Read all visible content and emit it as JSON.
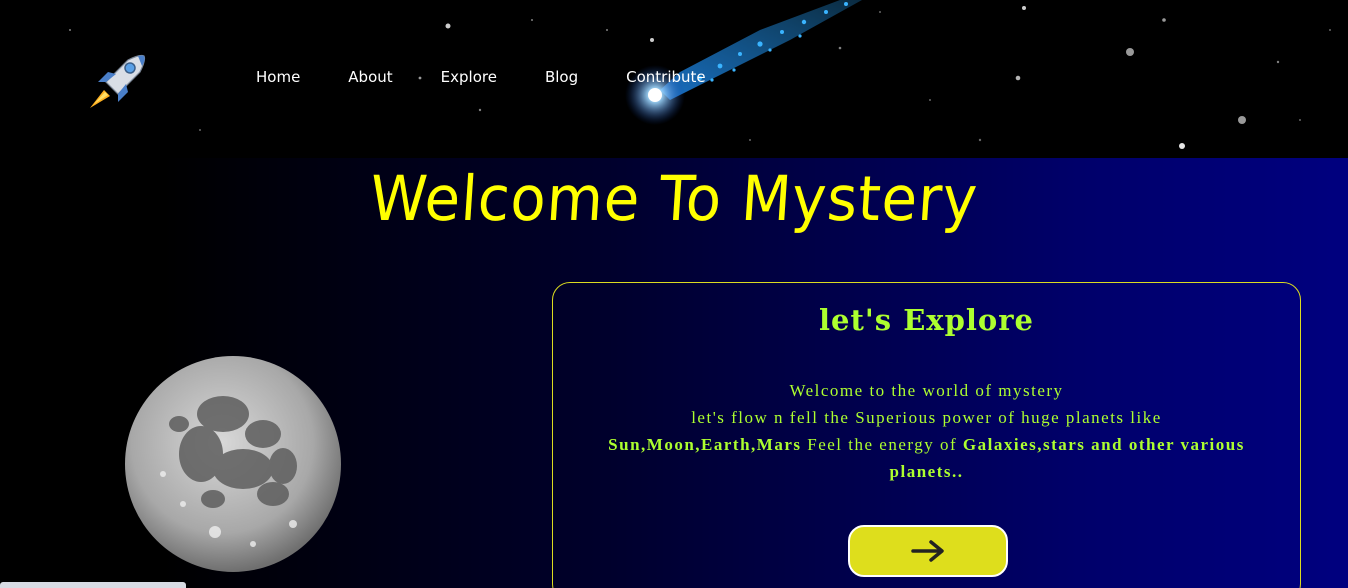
{
  "nav": {
    "items": [
      {
        "label": "Home"
      },
      {
        "label": "About"
      },
      {
        "label": "Explore"
      },
      {
        "label": "Blog"
      },
      {
        "label": "Contribute"
      }
    ],
    "logo_icon": "rocket-icon"
  },
  "hero": {
    "title": "Welcome To Mystery",
    "title_color": "#ffff00"
  },
  "card": {
    "title": "let's Explore",
    "line1": "Welcome to the world of mystery",
    "line2": "let's flow n fell the Superious power of huge planets like",
    "bold1": "Sun,Moon,Earth,Mars",
    "mid": " Feel the energy of ",
    "bold2": "Galaxies,stars and other various planets..",
    "text_color": "#adff2f",
    "button_icon": "arrow-right-icon",
    "button_color": "#dede1c"
  },
  "image": {
    "moon_icon": "moon-image"
  }
}
